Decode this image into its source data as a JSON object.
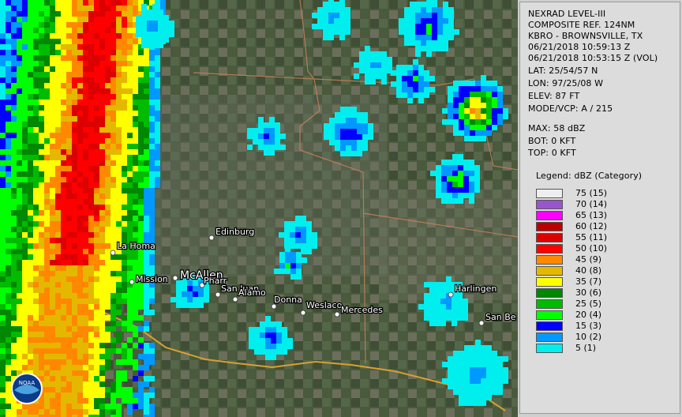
{
  "panel": {
    "lines": [
      "NEXRAD LEVEL-III",
      "COMPOSITE REF. 124NM",
      "KBRO - BROWNSVILLE, TX",
      "06/21/2018 10:59:13 Z",
      "06/21/2018 10:53:15 Z (VOL)",
      "LAT: 25/54/57 N",
      "LON: 97/25/08 W",
      "ELEV: 87 FT",
      "MODE/VCP: A / 215"
    ],
    "stats": [
      "MAX: 58 dBZ",
      "BOT: 0 KFT",
      "TOP: 0 KFT"
    ],
    "legend_title": "Legend: dBZ (Category)",
    "legend": [
      {
        "label": "75  (15)",
        "color": "#eeeeee"
      },
      {
        "label": "70  (14)",
        "color": "#9955cc"
      },
      {
        "label": "65  (13)",
        "color": "#ff00ff"
      },
      {
        "label": "60  (12)",
        "color": "#bb0000"
      },
      {
        "label": "55  (11)",
        "color": "#dd0000"
      },
      {
        "label": "50  (10)",
        "color": "#ff0000"
      },
      {
        "label": "45  (9)",
        "color": "#ff8800"
      },
      {
        "label": "40  (8)",
        "color": "#e5b800"
      },
      {
        "label": "35  (7)",
        "color": "#ffff00"
      },
      {
        "label": "30  (6)",
        "color": "#008800"
      },
      {
        "label": "25  (5)",
        "color": "#00bb00"
      },
      {
        "label": "20  (4)",
        "color": "#00ff00"
      },
      {
        "label": "15  (3)",
        "color": "#0000ff"
      },
      {
        "label": "10  (2)",
        "color": "#0099ff"
      },
      {
        "label": "5  (1)",
        "color": "#00eeee"
      }
    ]
  },
  "map": {
    "cities": [
      "Edinburg",
      "La Homa",
      "Mission",
      "McAllen",
      "Pharr",
      "San Juan",
      "Alamo",
      "Donna",
      "Weslaco",
      "Mercedes",
      "Harlingen",
      "San Be"
    ],
    "logo_text": "NOAA"
  }
}
